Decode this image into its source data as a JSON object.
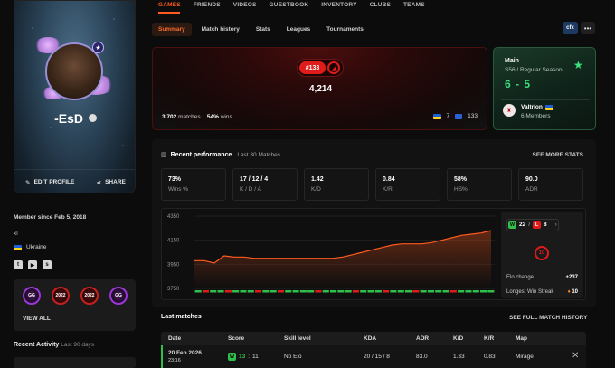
{
  "profile": {
    "nickname": "-EsD",
    "level_badge": "★",
    "edit_label": "EDIT PROFILE",
    "share_label": "SHARE",
    "member_since": "Member since Feb 5, 2018",
    "bio": "xl",
    "country": "Ukraine",
    "badges": [
      "GG",
      "2022",
      "2022",
      "GG"
    ],
    "view_all": "VIEW ALL",
    "recent_activity_title": "Recent Activity",
    "recent_activity_sub": "Last 90 days"
  },
  "nav": {
    "items": [
      "GAMES",
      "FRIENDS",
      "VIDEOS",
      "GUESTBOOK",
      "INVENTORY",
      "CLUBS",
      "TEAMS"
    ],
    "active": "GAMES"
  },
  "subtabs": {
    "items": [
      "Summary",
      "Match history",
      "Stats",
      "Leagues",
      "Tournaments"
    ],
    "active": "Summary",
    "game_logo": "cfx",
    "more": "•••"
  },
  "elo": {
    "rank": "#133",
    "value": "4,214",
    "matches": "3,702",
    "matches_label": "matches",
    "wins_pct": "54%",
    "wins_label": "wins",
    "country_rank": "7",
    "region_rank": "133"
  },
  "team": {
    "title": "Main",
    "subtitle": "S56 / Regular Season",
    "score": "6 - 5",
    "name": "Valtrion",
    "members": "6 Members"
  },
  "performance": {
    "title": "Recent performance",
    "subtitle": "Last 30 Matches",
    "see_more": "SEE MORE STATS",
    "stats": [
      {
        "value": "73%",
        "label": "Wins %"
      },
      {
        "value": "17 / 12 / 4",
        "label": "K / D / A"
      },
      {
        "value": "1.42",
        "label": "K/D"
      },
      {
        "value": "0.84",
        "label": "K/R"
      },
      {
        "value": "58%",
        "label": "HS%"
      },
      {
        "value": "90.0",
        "label": "ADR"
      }
    ],
    "wins": "22",
    "losses": "8",
    "level": "10",
    "elo_change_label": "Elo change",
    "elo_change": "+237",
    "streak_label": "Longest Win Streak",
    "streak": "10"
  },
  "chart_data": {
    "type": "line",
    "y_ticks": [
      "4350",
      "4150",
      "3950",
      "3750"
    ],
    "ylim": [
      3750,
      4350
    ],
    "values": [
      3980,
      3980,
      3960,
      4020,
      4010,
      4010,
      4000,
      4000,
      4000,
      4000,
      4000,
      4000,
      4000,
      4000,
      4000,
      4010,
      4030,
      4050,
      4070,
      4090,
      4110,
      4120,
      4120,
      4120,
      4130,
      4150,
      4170,
      4190,
      4200,
      4210,
      4230
    ],
    "results": [
      "W",
      "L",
      "W",
      "W",
      "L",
      "W",
      "W",
      "W",
      "L",
      "W",
      "W",
      "L",
      "W",
      "W",
      "W",
      "W",
      "L",
      "W",
      "W",
      "W",
      "W",
      "L",
      "W",
      "W",
      "W",
      "L",
      "W",
      "W",
      "W",
      "L",
      "W",
      "W",
      "W",
      "W",
      "L",
      "W",
      "W",
      "W",
      "W",
      "W"
    ],
    "line_color": "#ff5a1f",
    "win_color": "#2fbf4a",
    "loss_color": "#e01b1b"
  },
  "matches": {
    "title": "Last matches",
    "see_full": "SEE FULL MATCH HISTORY",
    "columns": [
      "Date",
      "Score",
      "Skill level",
      "KDA",
      "ADR",
      "K/D",
      "K/R",
      "Map"
    ],
    "rows": [
      {
        "date": "20 Feb 2026",
        "time": "23:16",
        "result": "W",
        "score_a": "13",
        "score_b": "11",
        "skill": "No Elo",
        "kda": "20 / 15 / 8",
        "adr": "83.0",
        "kd": "1.33",
        "kr": "0.83",
        "map": "Mirage"
      }
    ]
  },
  "colors": {
    "accent": "#ff5a1f",
    "win": "#2fbf4a",
    "loss": "#e01b1b"
  }
}
